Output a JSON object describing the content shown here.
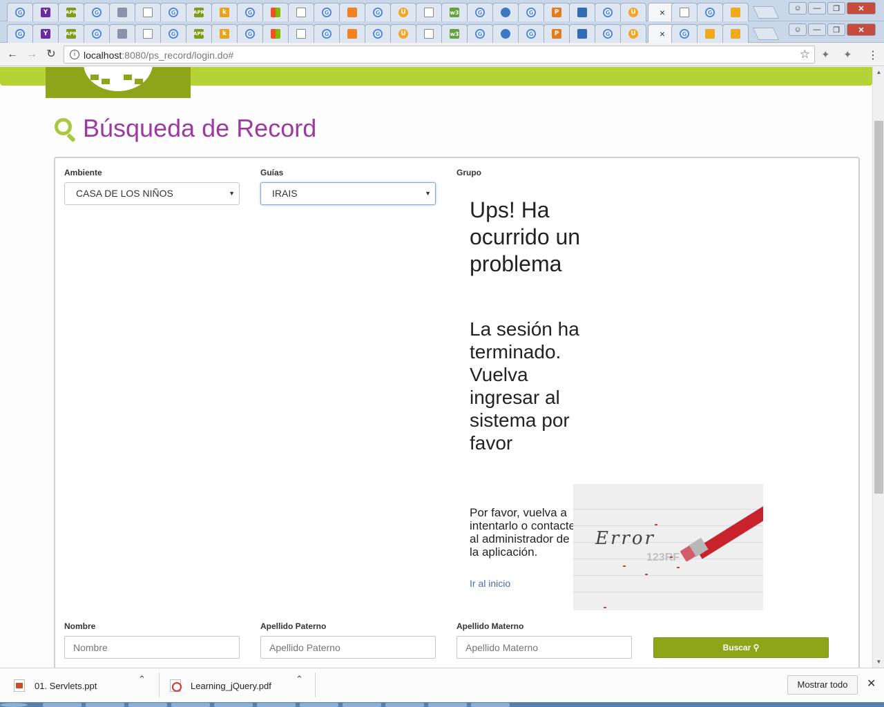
{
  "browser": {
    "url_host": "localhost",
    "url_rest": ":8080/ps_record/login.do#",
    "tab_close_glyph": "×",
    "icons": [
      "back-arrow-icon",
      "forward-arrow-icon",
      "reload-icon",
      "info-icon",
      "star-icon",
      "puzzle-icon"
    ]
  },
  "page": {
    "title": "Búsqueda de Record",
    "fields": {
      "ambiente_label": "Ambiente",
      "ambiente_value": "CASA DE LOS NIÑOS",
      "guias_label": "Guías",
      "guias_value": "IRAIS",
      "grupo_label": "Grupo",
      "nombre_label": "Nombre",
      "nombre_placeholder": "Nombre",
      "paterno_label": "Apellido Paterno",
      "paterno_placeholder": "Apellido Paterno",
      "materno_label": "Apellido Materno",
      "materno_placeholder": "Apellido Materno"
    },
    "error": {
      "heading": "Ups! Ha ocurrido un problema",
      "subheading": "La sesión ha terminado. Vuelva ingresar al sistema por favor",
      "message": "Por favor, vuelva a intentarlo o contacte al administrador de la aplicación.",
      "link": "Ir al inicio",
      "image_word": "Error",
      "image_watermark": "123RF"
    },
    "search_button": "Buscar"
  },
  "downloads": {
    "items": [
      "01. Servlets.ppt",
      "Learning_jQuery.pdf"
    ],
    "show_all": "Mostrar todo"
  },
  "colors": {
    "brand_green": "#8ea419",
    "light_green": "#b5d335",
    "title_purple": "#9d3aa2",
    "link_blue": "#3f6fb1"
  }
}
